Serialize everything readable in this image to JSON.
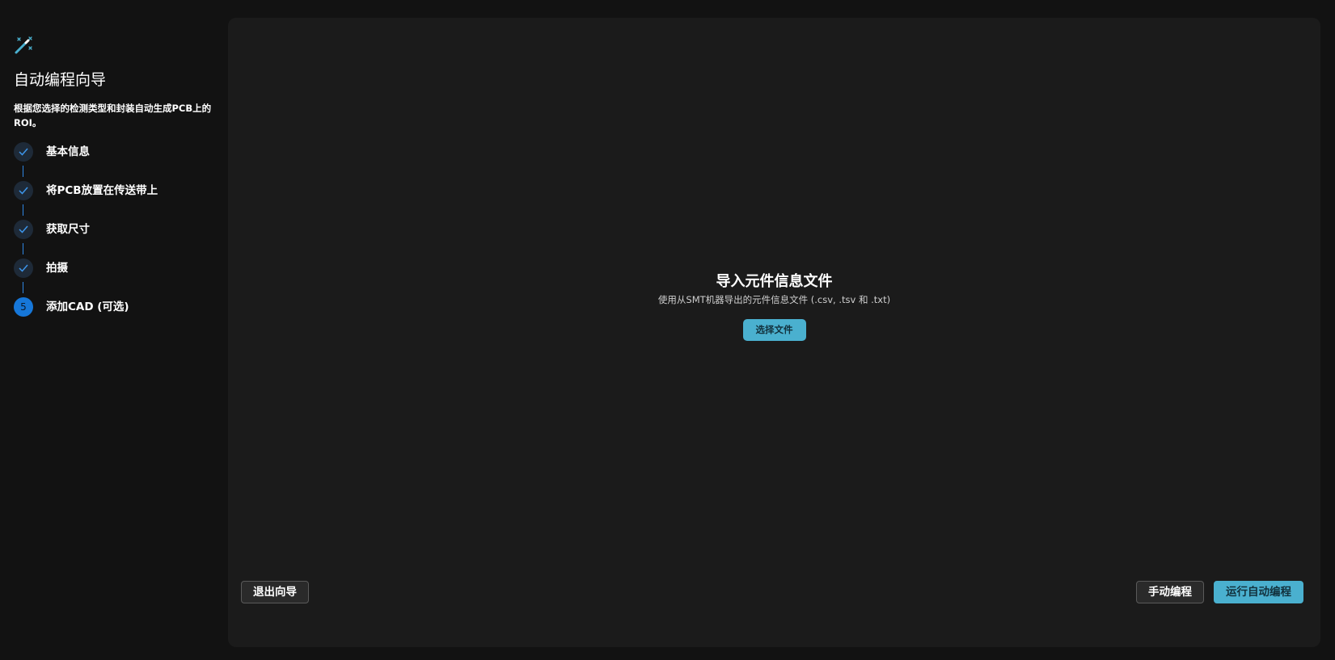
{
  "sidebar": {
    "icon": "magic-wand-icon",
    "title": "自动编程向导",
    "description": "根据您选择的检测类型和封装自动生成PCB上的ROI。",
    "steps": [
      {
        "label": "基本信息",
        "status": "done",
        "icon": "check-icon"
      },
      {
        "label": "将PCB放置在传送带上",
        "status": "done",
        "icon": "check-icon"
      },
      {
        "label": "获取尺寸",
        "status": "done",
        "icon": "check-icon"
      },
      {
        "label": "拍摄",
        "status": "done",
        "icon": "check-icon"
      },
      {
        "label": "添加CAD (可选)",
        "status": "active",
        "number": "5"
      }
    ]
  },
  "main": {
    "import_title": "导入元件信息文件",
    "import_subtitle": "使用从SMT机器导出的元件信息文件 (.csv, .tsv 和 .txt)",
    "select_file_label": "选择文件"
  },
  "footer": {
    "exit_label": "退出向导",
    "manual_label": "手动编程",
    "run_label": "运行自动编程"
  },
  "colors": {
    "accent": "#4ab0cf",
    "step_active": "#1677d9",
    "connector": "#2f86e4",
    "panel": "#1b1b1b",
    "background": "#121212"
  }
}
